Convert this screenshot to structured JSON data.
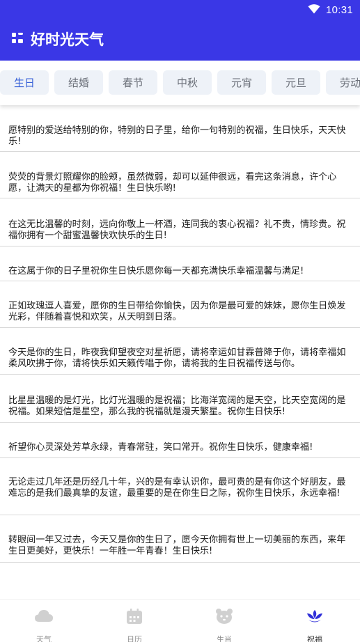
{
  "status_bar": {
    "time": "10:31",
    "wifi_icon": "wifi-icon"
  },
  "header": {
    "title": "好时光天气",
    "menu_icon": "grid-icon"
  },
  "tabs": [
    {
      "label": "生日",
      "active": true
    },
    {
      "label": "结婚",
      "active": false
    },
    {
      "label": "春节",
      "active": false
    },
    {
      "label": "中秋",
      "active": false
    },
    {
      "label": "元宵",
      "active": false
    },
    {
      "label": "元旦",
      "active": false
    },
    {
      "label": "劳动",
      "active": false
    }
  ],
  "wishes": [
    "愿特别的爱送给特别的你，特别的日子里，给你一句特别的祝福，生日快乐，天天快乐!",
    "荧荧的背景灯照耀你的脸颊，虽然微弱，却可以延伸很远，看完这条消息，许个心愿，让满天的星都为你祝福！生日快乐哟!",
    "在这无比温馨的时刻，远向你敬上一杯酒，连同我的衷心祝福？礼不贵，情珍贵。祝福你拥有一个甜蜜温馨快欢快乐的生日!",
    "在这属于你的日子里祝你生日快乐愿你每一天都充满快乐幸福温馨与满足!",
    "正如玫瑰逗人喜爱，愿你的生日带给你愉快，因为你是最可爱的妹妹，愿你生日焕发光彩，伴随着喜悦和欢笑，从天明到日落。",
    "今天是你的生日，昨夜我仰望夜空对星祈愿，请将幸运如甘霖普降于你，请将幸福如柔风吹拂于你，请将快乐如天籁传唱于你，请将我的生日祝福传送与你。",
    "比星星温暖的是灯光，比灯光温暖的是祝福；比海洋宽阔的是天空，比天空宽阔的是祝福。如果短信是星空，那么我的祝福就是漫天繁星。祝你生日快乐!",
    "祈望你心灵深处芳草永绿，青春常驻，笑口常开。祝你生日快乐，健康幸福!",
    "无论走过几年还是历经几十年，兴的是有幸认识你，最可贵的是有你这个好朋友，最难忘的是我们最真挚的友谊，最重要的是在你生日之际，祝你生日快乐，永远幸福!",
    "转眼间一年又过去，今天又是你的生日了，愿今天你拥有世上一切美丽的东西，来年生日更美好，更快乐！一年胜一年青春！生日快乐!"
  ],
  "bottom_nav": [
    {
      "label": "天气",
      "icon": "cloud-icon",
      "active": false
    },
    {
      "label": "日历",
      "icon": "calendar-icon",
      "active": false
    },
    {
      "label": "生肖",
      "icon": "zodiac-icon",
      "active": false
    },
    {
      "label": "祝福",
      "icon": "lotus-icon",
      "active": true
    }
  ],
  "colors": {
    "header": "#3a37e6",
    "tab_bg": "#eef2f8",
    "tab_active_text": "#3a63d8",
    "nav_inactive_icon": "#d0d0d0",
    "nav_active_icon": "#2f2fd8"
  }
}
